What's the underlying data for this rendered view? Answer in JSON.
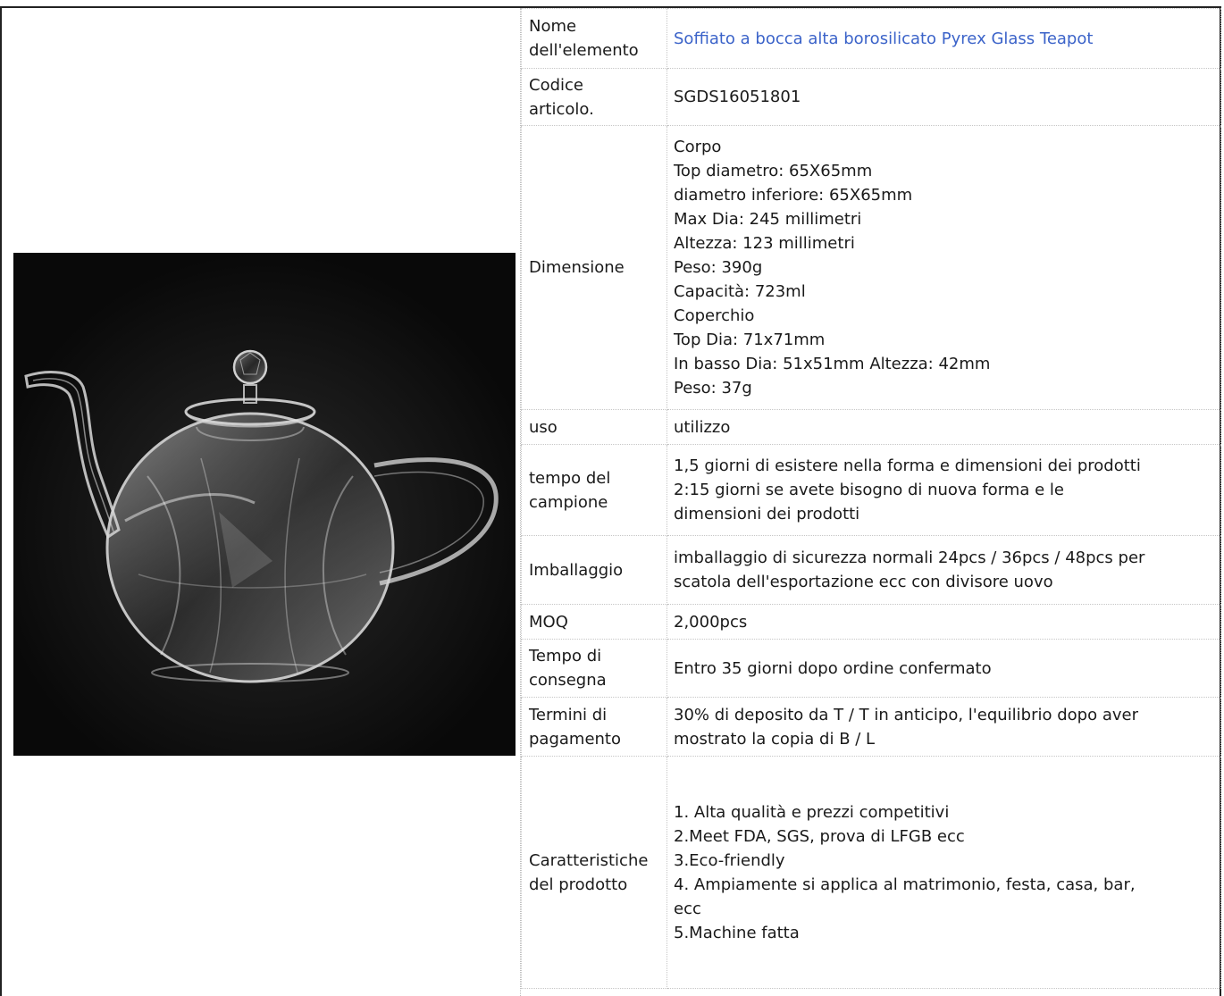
{
  "product": {
    "image_alt": "Pyrex glass teapot on black background"
  },
  "rows": [
    {
      "label": "Nome\ndell'elemento",
      "value": "Soffiato a bocca alta borosilicato Pyrex Glass Teapot"
    },
    {
      "label": "Codice\narticolo.",
      "value": "SGDS16051801"
    },
    {
      "label": "Dimensione",
      "value": "Corpo\nTop diametro: 65X65mm\ndiametro inferiore: 65X65mm\nMax Dia: 245 millimetri\nAltezza: 123 millimetri\nPeso: 390g\nCapacità: 723ml\nCoperchio\nTop Dia: 71x71mm\nIn basso Dia: 51x51mm Altezza: 42mm\nPeso: 37g"
    },
    {
      "label": "uso",
      "value": "utilizzo"
    },
    {
      "label": "tempo del\ncampione",
      "value": "1,5 giorni di esistere nella forma e dimensioni dei prodotti\n2:15 giorni se avete bisogno di nuova forma e le\ndimensioni dei prodotti"
    },
    {
      "label": "Imballaggio",
      "value": "imballaggio di sicurezza normali 24pcs / 36pcs / 48pcs per\nscatola dell'esportazione ecc con divisore uovo"
    },
    {
      "label": "MOQ",
      "value": "2,000pcs"
    },
    {
      "label": "Tempo di\nconsegna",
      "value": "Entro 35 giorni dopo ordine confermato"
    },
    {
      "label": "Termini di\npagamento",
      "value": "30% di deposito da T / T in anticipo, l'equilibrio dopo aver\nmostrato la copia di B / L"
    },
    {
      "label": "Caratteristiche\ndel prodotto",
      "value": "1. Alta qualità e prezzi competitivi\n2.Meet FDA, SGS, prova di LFGB ecc\n3.Eco-friendly\n4. Ampiamente si applica al matrimonio, festa, casa, bar,\necc\n5.Machine fatta"
    }
  ],
  "colors": {
    "link": "#3b63c9",
    "photo_bg": "#0b0b0b",
    "border": "#222222"
  }
}
